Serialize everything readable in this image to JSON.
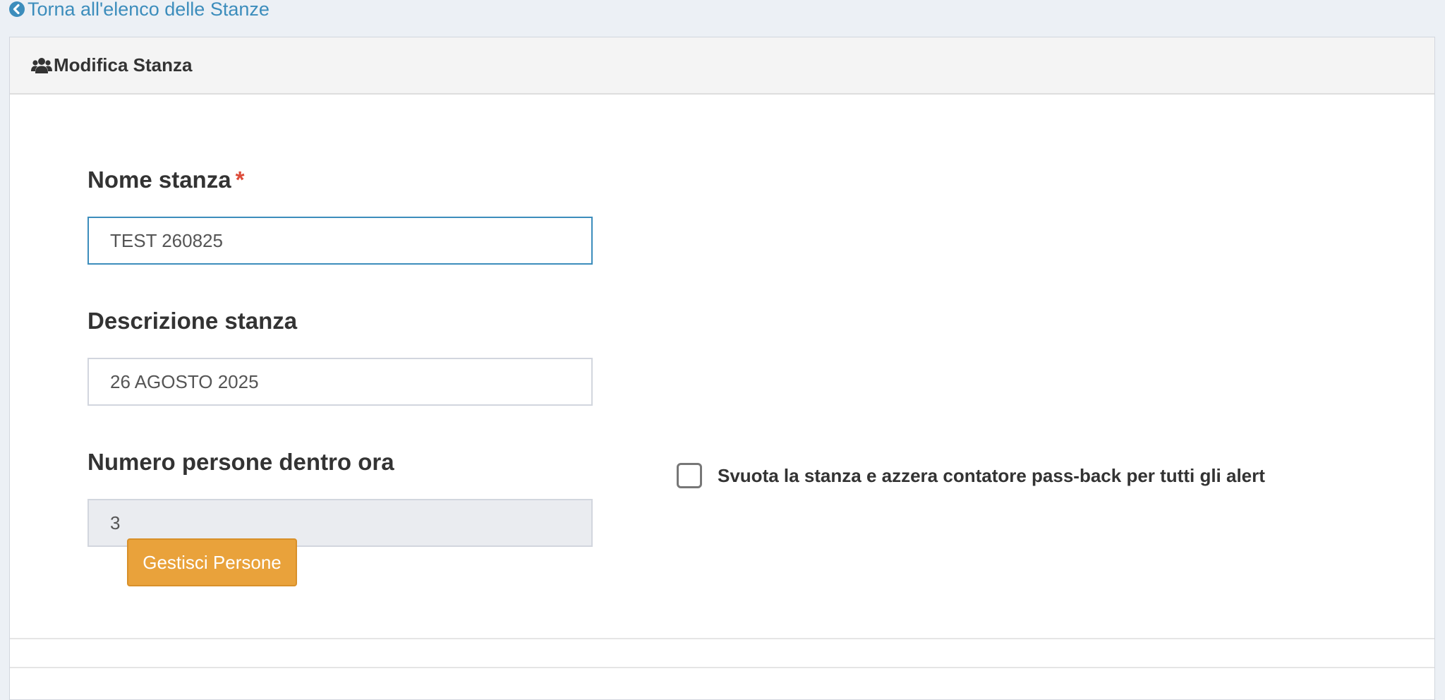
{
  "back_link": {
    "label": "Torna all'elenco delle Stanze",
    "icon": "chevron-circle-left-icon"
  },
  "panel": {
    "title": "Modifica Stanza",
    "icon": "users-icon"
  },
  "form": {
    "name": {
      "label": "Nome stanza",
      "required_mark": "*",
      "value": "TEST 260825"
    },
    "description": {
      "label": "Descrizione stanza",
      "value": "26 AGOSTO 2025"
    },
    "people_count": {
      "label": "Numero persone dentro ora",
      "value": "3"
    },
    "reset_checkbox": {
      "label": "Svuota la stanza e azzera contatore pass-back per tutti gli alert",
      "checked": false
    },
    "manage_button": {
      "label": "Gestisci Persone"
    }
  },
  "colors": {
    "link": "#3c8dbc",
    "required": "#dd4b39",
    "warning_button": "#e9a23b",
    "page_background": "#ecf0f5"
  }
}
